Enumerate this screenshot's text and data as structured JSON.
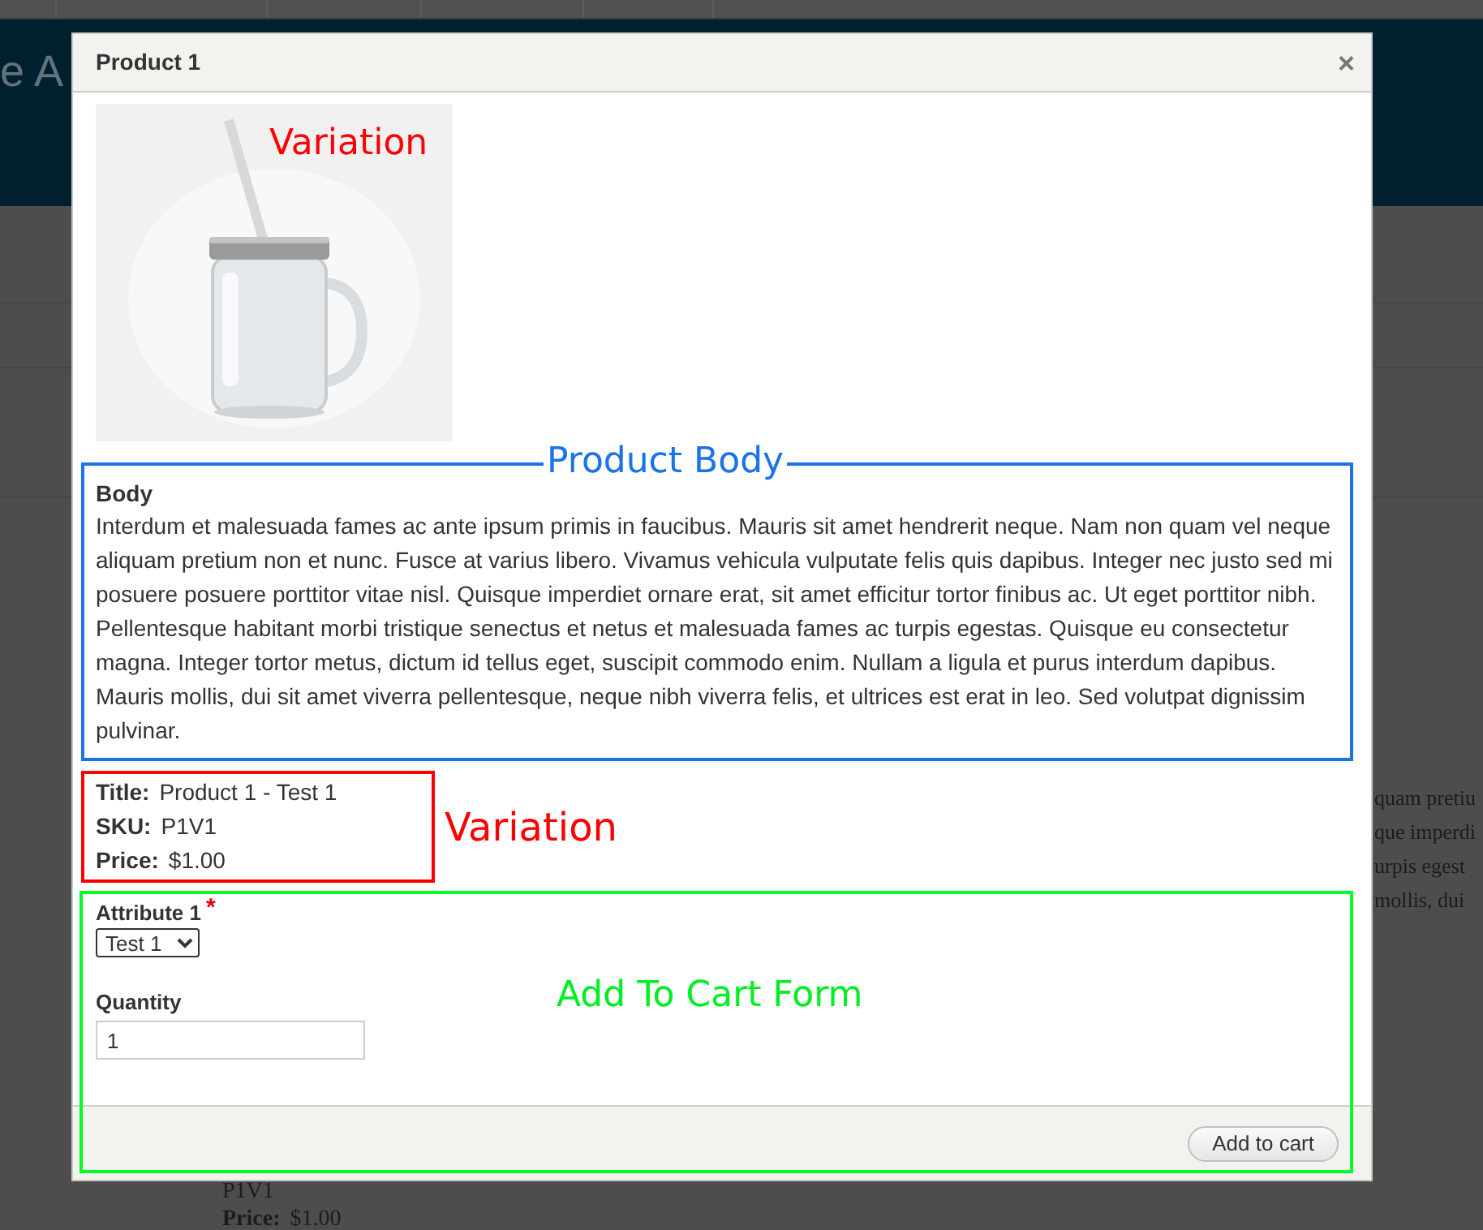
{
  "background": {
    "header_text": "e A",
    "side_texts": [
      "quam pretiu",
      "que imperdi",
      "urpis egest",
      "mollis, dui"
    ],
    "bottom_sku": "P1V1",
    "bottom_price_label": "Price:",
    "bottom_price": "$1.00"
  },
  "dialog": {
    "title": "Product 1",
    "close": "×",
    "image_annotation": "Variation",
    "body": {
      "annotation": "Product Body",
      "label": "Body",
      "text": "Interdum et malesuada fames ac ante ipsum primis in faucibus. Mauris sit amet hendrerit neque. Nam non quam vel neque aliquam pretium non et nunc. Fusce at varius libero. Vivamus vehicula vulputate felis quis dapibus. Integer nec justo sed mi posuere posuere porttitor vitae nisl. Quisque imperdiet ornare erat, sit amet efficitur tortor finibus ac. Ut eget porttitor nibh. Pellentesque habitant morbi tristique senectus et netus et malesuada fames ac turpis egestas. Quisque eu consectetur magna. Integer tortor metus, dictum id tellus eget, suscipit commodo enim. Nullam a ligula et purus interdum dapibus. Mauris mollis, dui sit amet viverra pellentesque, neque nibh viverra felis, et ultrices est erat in leo. Sed volutpat dignissim pulvinar."
    },
    "variation": {
      "annotation": "Variation",
      "fields": [
        {
          "label": "Title:",
          "value": "Product 1 - Test 1"
        },
        {
          "label": "SKU:",
          "value": "P1V1"
        },
        {
          "label": "Price:",
          "value": "$1.00"
        }
      ]
    },
    "form": {
      "annotation": "Add To Cart Form",
      "attribute": {
        "label": "Attribute 1",
        "required": true,
        "required_mark": "*",
        "value": "Test 1"
      },
      "quantity": {
        "label": "Quantity",
        "value": "1"
      },
      "submit": "Add to cart"
    }
  }
}
